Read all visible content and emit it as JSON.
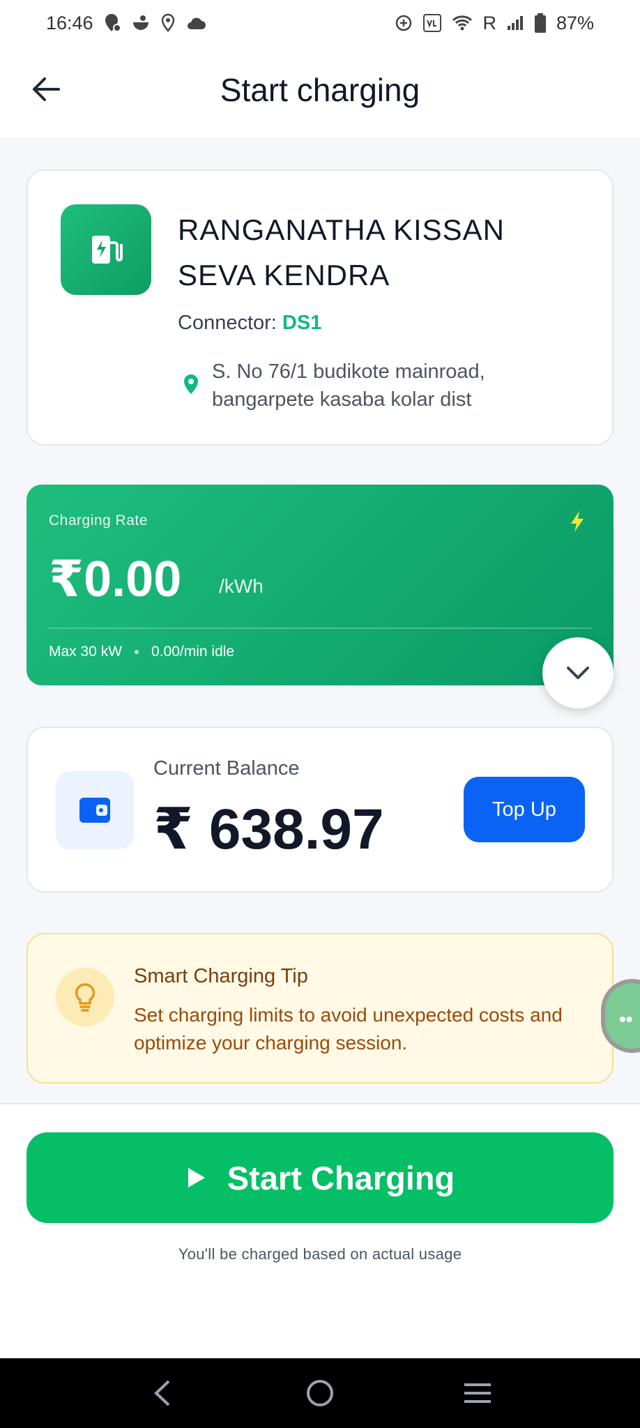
{
  "status_bar": {
    "time": "16:46",
    "battery": "87%",
    "network_letter": "R"
  },
  "app_bar": {
    "title": "Start charging"
  },
  "station": {
    "name": "RANGANATHA KISSAN SEVA KENDRA",
    "connector_label": "Connector:",
    "connector_value": "DS1",
    "address": "S. No 76/1 budikote mainroad, bangarpete kasaba kolar dist"
  },
  "rate": {
    "label": "Charging Rate",
    "value": "₹0.00",
    "unit": "/kWh",
    "max_power": "Max 30 kW",
    "idle_fee": "0.00/min idle"
  },
  "balance": {
    "label": "Current Balance",
    "value": "₹ 638.97",
    "topup_label": "Top Up"
  },
  "tip": {
    "title": "Smart Charging Tip",
    "text": "Set charging limits to avoid unexpected costs and optimize your charging session."
  },
  "action": {
    "start_label": "Start Charging",
    "note": "You'll be charged based on actual usage"
  },
  "colors": {
    "primary_green": "#04BF66",
    "accent_blue": "#0A63F5",
    "tip_bg": "#FFF9E6"
  }
}
